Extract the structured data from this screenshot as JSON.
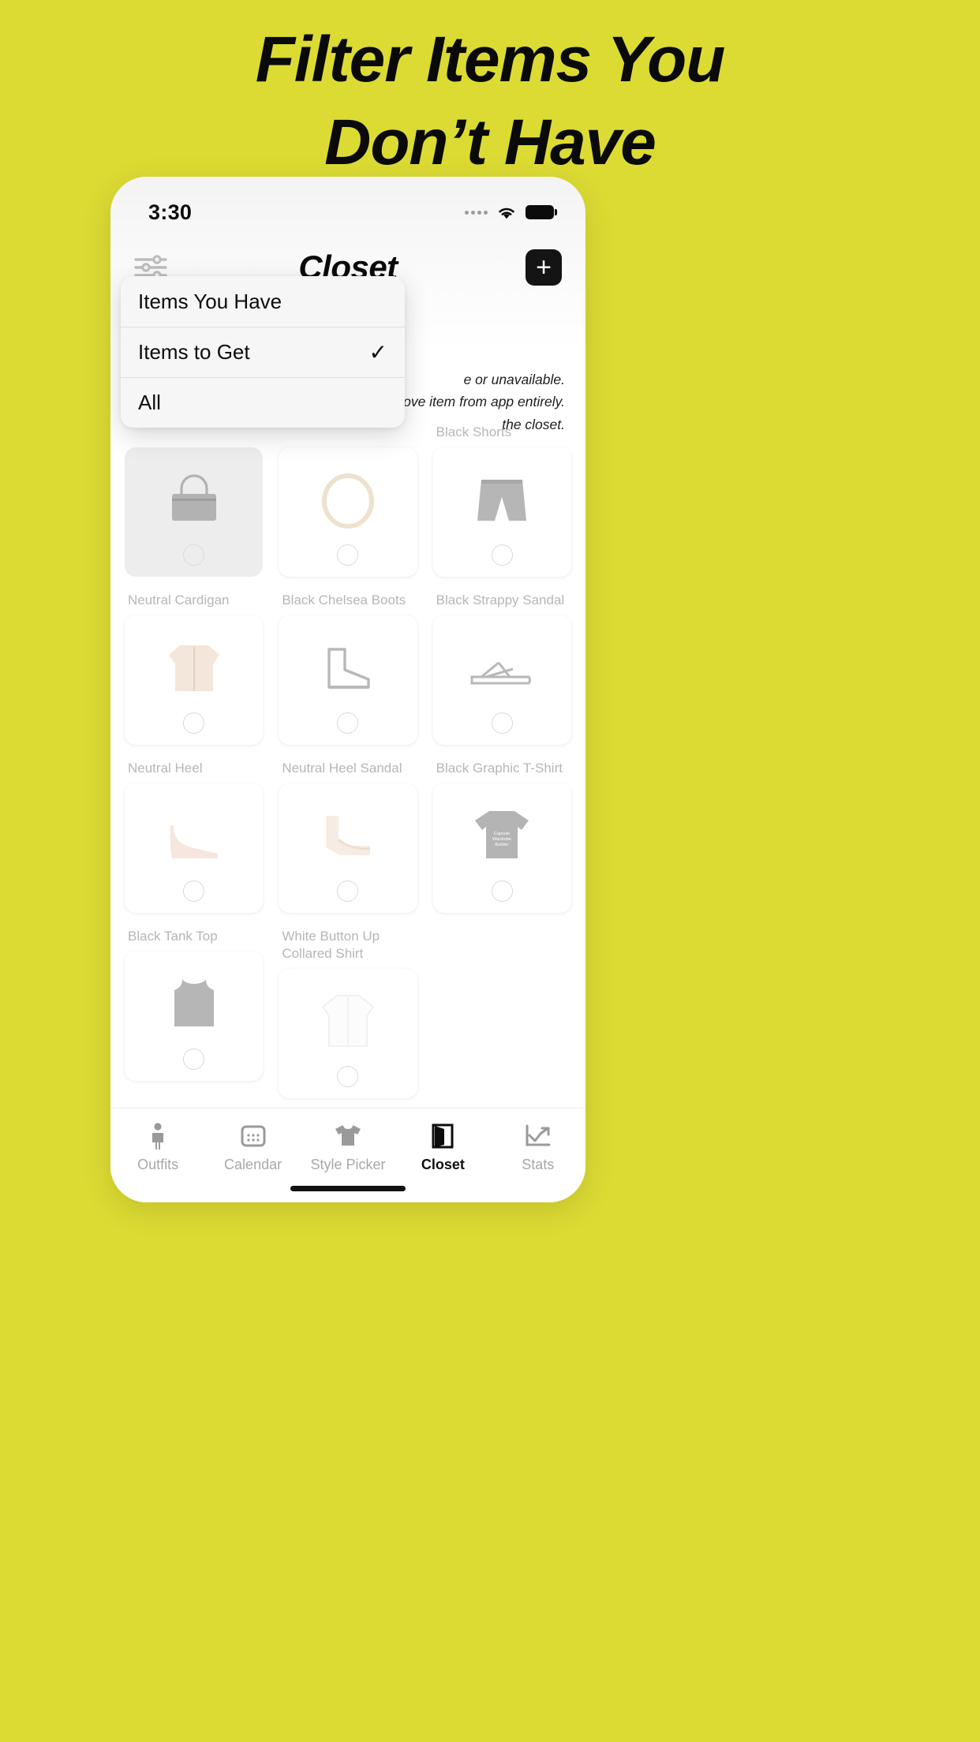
{
  "promo": {
    "headline_line1": "Filter Items You",
    "headline_line2": "Don’t Have",
    "background_color": "#dcdb33"
  },
  "status_bar": {
    "time": "3:30",
    "signal_icon": "signal-dots-icon",
    "wifi_icon": "wifi-icon",
    "battery_icon": "battery-full-icon"
  },
  "nav": {
    "filter_icon": "filter-sliders-icon",
    "title": "Closet",
    "add_label": "+",
    "add_icon": "plus-icon"
  },
  "help_text": {
    "line1": "e or unavailable.",
    "line2": "ove item from app entirely.",
    "line3": "the closet."
  },
  "filter_menu": {
    "items": [
      {
        "label": "Items You Have",
        "checked": false,
        "check_glyph": ""
      },
      {
        "label": "Items to Get",
        "checked": true,
        "check_glyph": "✓"
      },
      {
        "label": "All",
        "checked": false,
        "check_glyph": ""
      }
    ]
  },
  "closet_grid": {
    "rows": [
      [
        {
          "label": "",
          "art": "handbag",
          "selected": false
        },
        {
          "label": "",
          "art": "necklace",
          "selected": false
        },
        {
          "label": "Black Shorts",
          "art": "shorts",
          "selected": false
        }
      ],
      [
        {
          "label": "Neutral Cardigan",
          "art": "cardigan",
          "selected": false
        },
        {
          "label": "Black Chelsea Boots",
          "art": "boot",
          "selected": false
        },
        {
          "label": "Black Strappy Sandal",
          "art": "sandal",
          "selected": false
        }
      ],
      [
        {
          "label": "Neutral Heel",
          "art": "heel",
          "selected": false
        },
        {
          "label": "Neutral Heel Sandal",
          "art": "heel-sandal",
          "selected": false
        },
        {
          "label": "Black Graphic T-Shirt",
          "art": "graphic-tee",
          "selected": false
        }
      ],
      [
        {
          "label": "Black Tank Top",
          "art": "tank-top",
          "selected": false
        },
        {
          "label": "White Button Up Collared Shirt",
          "art": "button-up",
          "selected": false
        },
        {
          "label": "",
          "art": "",
          "selected": false
        }
      ]
    ],
    "graphic_tee_text": "Capsule Wardrobe Builder"
  },
  "tab_bar": {
    "tabs": [
      {
        "label": "Outfits",
        "icon": "person-icon",
        "active": false
      },
      {
        "label": "Calendar",
        "icon": "calendar-icon",
        "active": false
      },
      {
        "label": "Style Picker",
        "icon": "tshirt-icon",
        "active": false
      },
      {
        "label": "Closet",
        "icon": "closet-door-icon",
        "active": true
      },
      {
        "label": "Stats",
        "icon": "chart-trend-icon",
        "active": false
      }
    ]
  }
}
